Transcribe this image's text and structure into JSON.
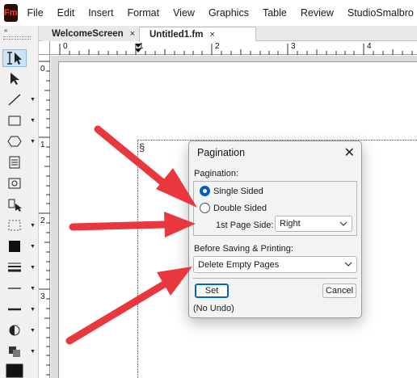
{
  "app": {
    "logo_text": "Fm",
    "menu": [
      "File",
      "Edit",
      "Insert",
      "Format",
      "View",
      "Graphics",
      "Table",
      "Review",
      "StudioSmalbro"
    ]
  },
  "tabs": [
    {
      "label": "WelcomeScreen",
      "close": "×"
    },
    {
      "label": "Untitled1.fm",
      "close": "×"
    }
  ],
  "toolbar": {
    "collapse": "«",
    "tools": [
      "text-cursor-icon",
      "select-arrow-icon",
      "line-icon",
      "rectangle-icon",
      "polygon-icon",
      "text-frame-icon",
      "image-frame-icon",
      "smart-select-icon",
      "marquee-icon",
      "fill-icon",
      "line-width-icon",
      "line-end-icon",
      "tint-icon",
      "overprint-icon",
      "color-icon"
    ]
  },
  "rulers": {
    "horizontal": [
      "0",
      "1",
      "2",
      "3",
      "4"
    ],
    "vertical": [
      "0",
      "1",
      "2",
      "3"
    ]
  },
  "document": {
    "section_mark": "§"
  },
  "dialog": {
    "title": "Pagination",
    "close": "✕",
    "pagination_label": "Pagination:",
    "single_sided": "Single Sided",
    "double_sided": "Double Sided",
    "first_page_side_label": "1st Page Side:",
    "first_page_side_value": "Right",
    "before_saving_label": "Before Saving & Printing:",
    "before_saving_value": "Delete Empty Pages",
    "set_button": "Set",
    "cancel_button": "Cancel",
    "undo_note": "(No Undo)",
    "selected_option": "single_sided"
  },
  "colors": {
    "arrow": "#e8383d",
    "accent": "#0067c0",
    "logo_bg": "#2c0b06",
    "logo_text": "#ff3b1f"
  }
}
